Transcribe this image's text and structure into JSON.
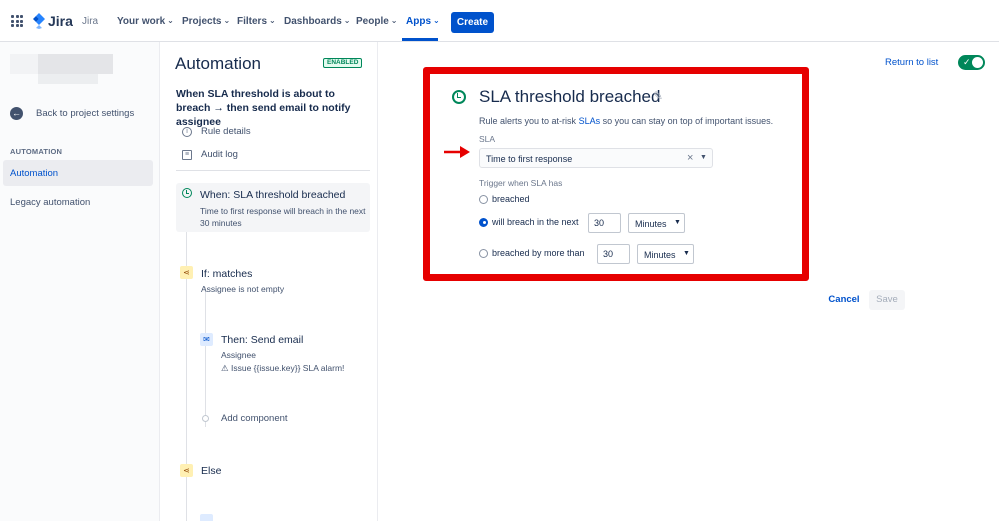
{
  "topnav": {
    "logo_text": "Jira",
    "product": "Jira",
    "items": [
      {
        "label": "Your work"
      },
      {
        "label": "Projects"
      },
      {
        "label": "Filters"
      },
      {
        "label": "Dashboards"
      },
      {
        "label": "People"
      },
      {
        "label": "Apps"
      }
    ],
    "create_label": "Create"
  },
  "sidebar": {
    "back_label": "Back to project settings",
    "section_heading": "AUTOMATION",
    "items": [
      {
        "label": "Automation",
        "active": true
      },
      {
        "label": "Legacy automation",
        "active": false
      }
    ]
  },
  "rule": {
    "title": "Automation",
    "status_badge": "ENABLED",
    "description": "When SLA threshold is about to breach → then send email to notify assignee",
    "links": [
      {
        "label": "Rule details",
        "icon": "info-icon"
      },
      {
        "label": "Audit log",
        "icon": "document-icon"
      }
    ],
    "trigger": {
      "title": "When: SLA threshold breached",
      "subtitle": "Time to first response will breach in the next 30 minutes"
    },
    "condition": {
      "title": "If: matches",
      "subtitle": "Assignee is not empty"
    },
    "action": {
      "title": "Then: Send email",
      "line1": "Assignee",
      "line2": "⚠ Issue {{issue.key}} SLA alarm!"
    },
    "add_component": "Add component",
    "else_label": "Else"
  },
  "header_actions": {
    "return_label": "Return to list",
    "rule_enabled": true
  },
  "sla_config": {
    "heading": "SLA threshold breached",
    "help_prefix": "Rule alerts you to at-risk",
    "help_link": "SLAs",
    "help_suffix": "so you can stay on top of important issues.",
    "sla_label": "SLA",
    "sla_value": "Time to first response",
    "trigger_label": "Trigger when SLA has",
    "options": [
      {
        "label": "breached",
        "selected": false
      },
      {
        "label": "will breach in the next",
        "selected": true,
        "amount": "30",
        "unit": "Minutes"
      },
      {
        "label": "breached by more than",
        "selected": false,
        "amount": "30",
        "unit": "Minutes"
      }
    ]
  },
  "footer": {
    "cancel_label": "Cancel",
    "save_label": "Save"
  },
  "colors": {
    "brand": "#0052cc",
    "success": "#00875a",
    "highlight": "#e60000"
  }
}
